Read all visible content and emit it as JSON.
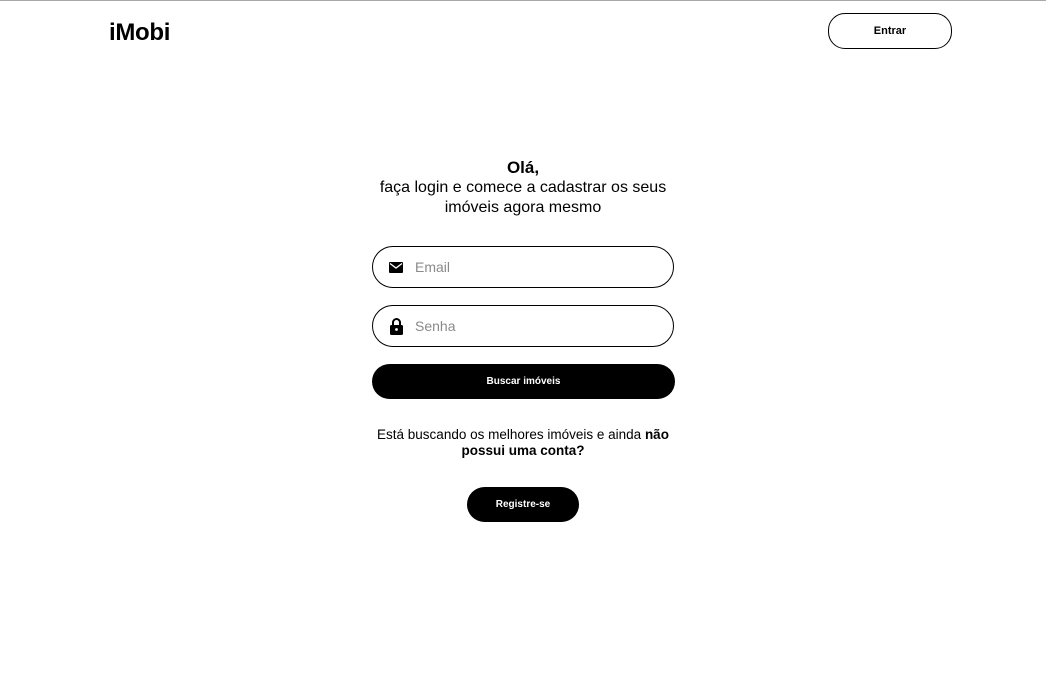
{
  "header": {
    "logo": "iMobi",
    "login_label": "Entrar"
  },
  "greeting": {
    "hello": "Olá,",
    "subtitle": "faça login e comece a cadastrar os seus imóveis agora mesmo"
  },
  "form": {
    "email": {
      "placeholder": "Email",
      "value": "",
      "icon": "mail-icon"
    },
    "password": {
      "placeholder": "Senha",
      "value": "",
      "icon": "lock-icon"
    },
    "submit_label": "Buscar imóveis"
  },
  "signup": {
    "prompt_text": "Está buscando os melhores imóveis e ainda ",
    "prompt_bold": "não possui uma conta?",
    "register_label": "Registre-se"
  },
  "colors": {
    "primary": "#000000",
    "background": "#ffffff",
    "placeholder": "#8a8a8a"
  }
}
